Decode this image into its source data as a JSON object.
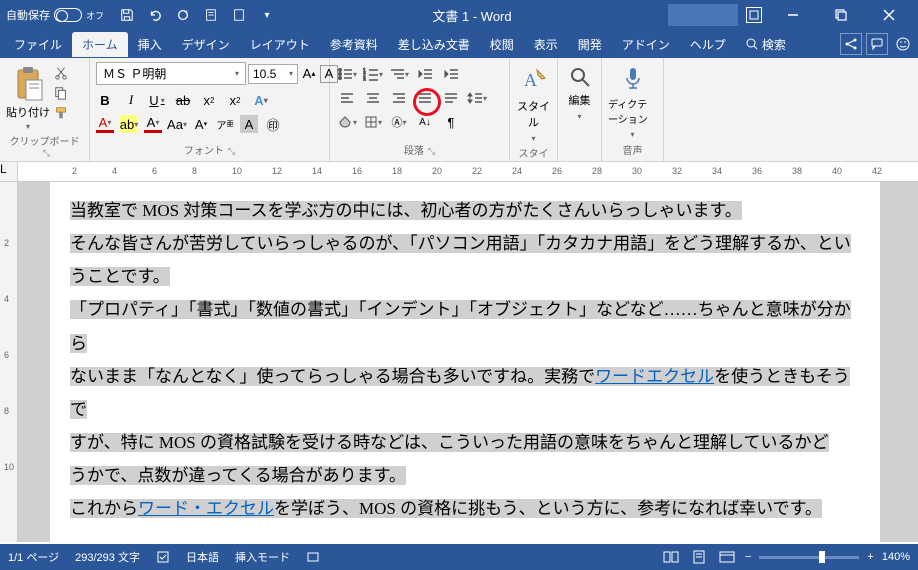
{
  "titlebar": {
    "autosave_label": "自動保存",
    "autosave_state": "オフ",
    "title": "文書 1  -  Word"
  },
  "menu": {
    "file": "ファイル",
    "home": "ホーム",
    "insert": "挿入",
    "design": "デザイン",
    "layout": "レイアウト",
    "references": "参考資料",
    "mailings": "差し込み文書",
    "review": "校閲",
    "view": "表示",
    "developer": "開発",
    "addins": "アドイン",
    "help": "ヘルプ",
    "search": "検索"
  },
  "ribbon": {
    "clipboard": {
      "title": "クリップボード",
      "paste": "貼り付け"
    },
    "font": {
      "title": "フォント",
      "name": "ＭＳ Ｐ明朝",
      "size": "10.5"
    },
    "paragraph": {
      "title": "段落"
    },
    "styles": {
      "title": "スタイル",
      "label": "スタイル"
    },
    "editing": {
      "title": "",
      "label": "編集"
    },
    "voice": {
      "title": "音声",
      "label": "ディクテーション"
    }
  },
  "document": {
    "p1": "当教室で MOS 対策コースを学ぶ方の中には、初心者の方がたくさんいらっしゃいます。",
    "p2a": "そんな皆さんが苦労していらっしゃるのが、「パソコン用語」「カタカナ用語」をどう理解するか、とい",
    "p2b": "うことです。",
    "p3a": "「プロパティ」「書式」「数値の書式」「インデント」「オブジェクト」などなど……ちゃんと意味が分から",
    "p3b": "ないまま「なんとなく」使ってらっしゃる場合も多いですね。実務で",
    "link1": "ワードエクセル",
    "p3c": "を使うときもそうで",
    "p3d": "すが、特に MOS の資格試験を受ける時などは、こういった用語の意味をちゃんと理解しているかど",
    "p3e": "うかで、点数が違ってくる場合があります。",
    "p4a": "これから",
    "link2": "ワード・エクセル",
    "p4b": "を学ぼう、MOS の資格に挑もう、という方に、参考になれば幸いです。"
  },
  "statusbar": {
    "page": "1/1 ページ",
    "words": "293/293 文字",
    "language": "日本語",
    "insert_mode": "挿入モード",
    "zoom": "140%"
  }
}
